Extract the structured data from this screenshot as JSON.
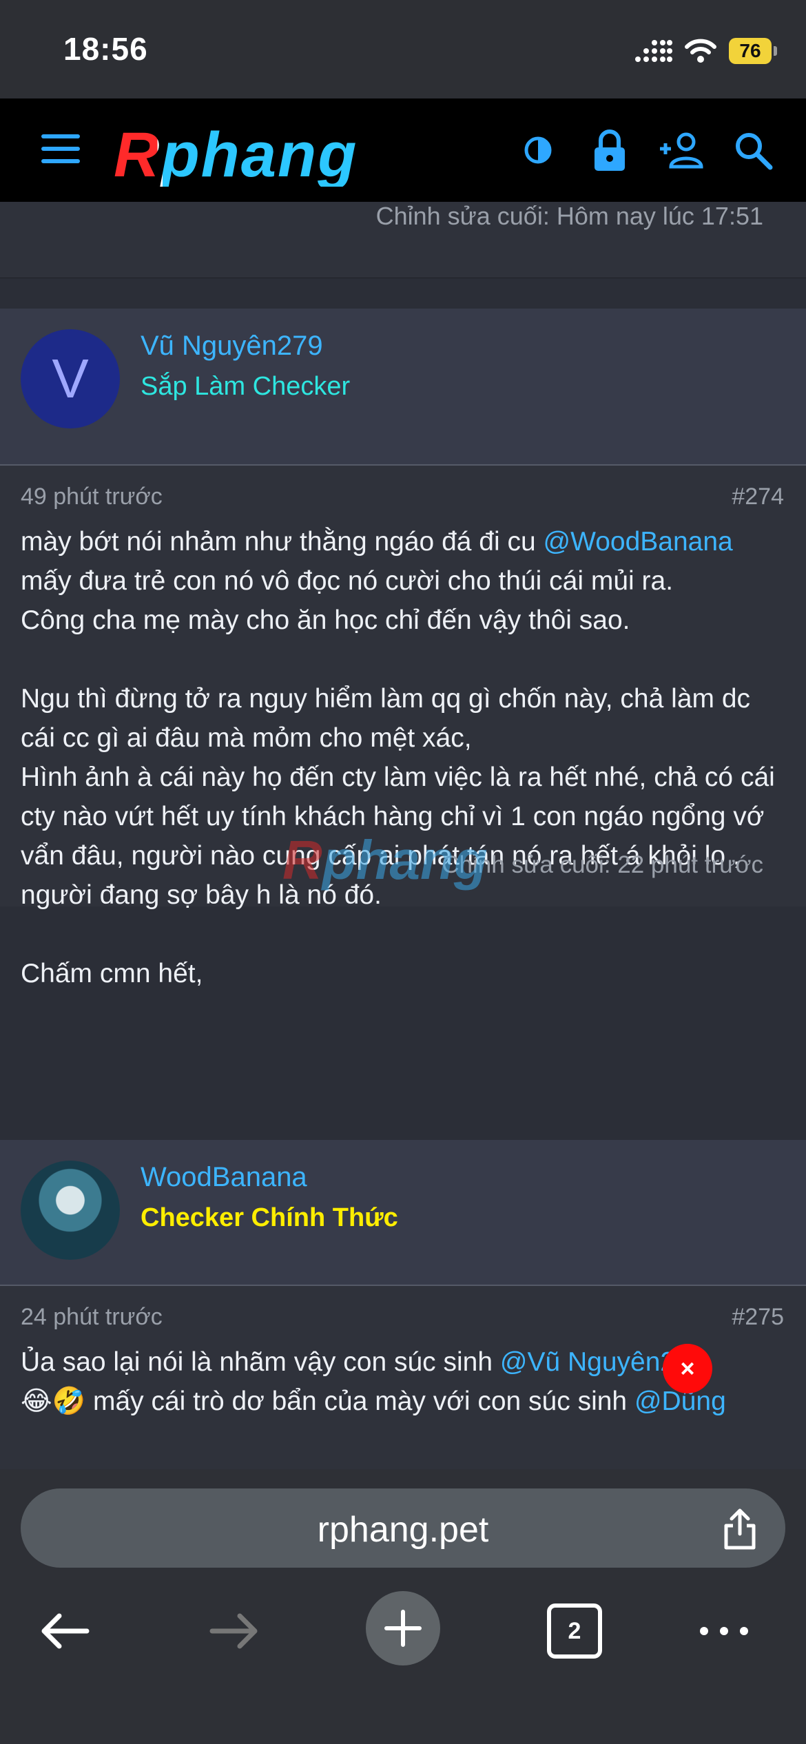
{
  "status": {
    "time": "18:56",
    "battery": "76"
  },
  "nav": {
    "logo": "Rphang"
  },
  "prev_post": {
    "edited": "Chỉnh sửa cuối: Hôm nay lúc 17:51"
  },
  "posts": [
    {
      "username": "Vũ Nguyên279",
      "avatar_letter": "V",
      "title": "Sắp Làm Checker",
      "title_color": "#2ee6e0",
      "time": "49 phút trước",
      "number": "#274",
      "text_1": "mày bớt nói nhảm như thằng ngáo đá đi cu ",
      "mention_1": "@WoodBanana",
      "text_2": "\nmấy đưa trẻ con nó vô đọc nó cười cho thúi cái mủi ra.\nCông cha mẹ mày cho ăn học chỉ đến vậy thôi sao.\n\nNgu thì đừng tở ra nguy hiểm làm qq gì chốn này, chả làm dc cái cc gì ai đâu mà mỏm cho mệt xác,\nHình ảnh à cái này họ đến cty làm việc là ra hết nhé, chả có cái cty nào vứt hết uy tính khách hàng chỉ vì 1 con ngáo ngổng vớ vẩn đâu, người nào cung cấp ai phát tán nó ra hết á khỏi lo , người đang sợ bây h là nó đó.\n\nChấm cmn hết,",
      "edited": "Chỉnh sửa cuối: 22 phút trước"
    },
    {
      "username": "WoodBanana",
      "title": "Checker Chính Thức",
      "title_color": "#ffee00",
      "time": "24 phút trước",
      "number": "#275",
      "text_1": "Ủa sao lại nói là nhãm vậy con súc sinh ",
      "mention_1": "@Vũ Nguyên279",
      "text_2": "\n😂🤣 mấy cái trò dơ bẩn của mày với con súc sinh ",
      "mention_2": "@Dũng"
    }
  ],
  "watermark": {
    "red": "R",
    "rest": "phang"
  },
  "close_label": "×",
  "browser": {
    "url": "rphang.pet",
    "tab_count": "2"
  }
}
